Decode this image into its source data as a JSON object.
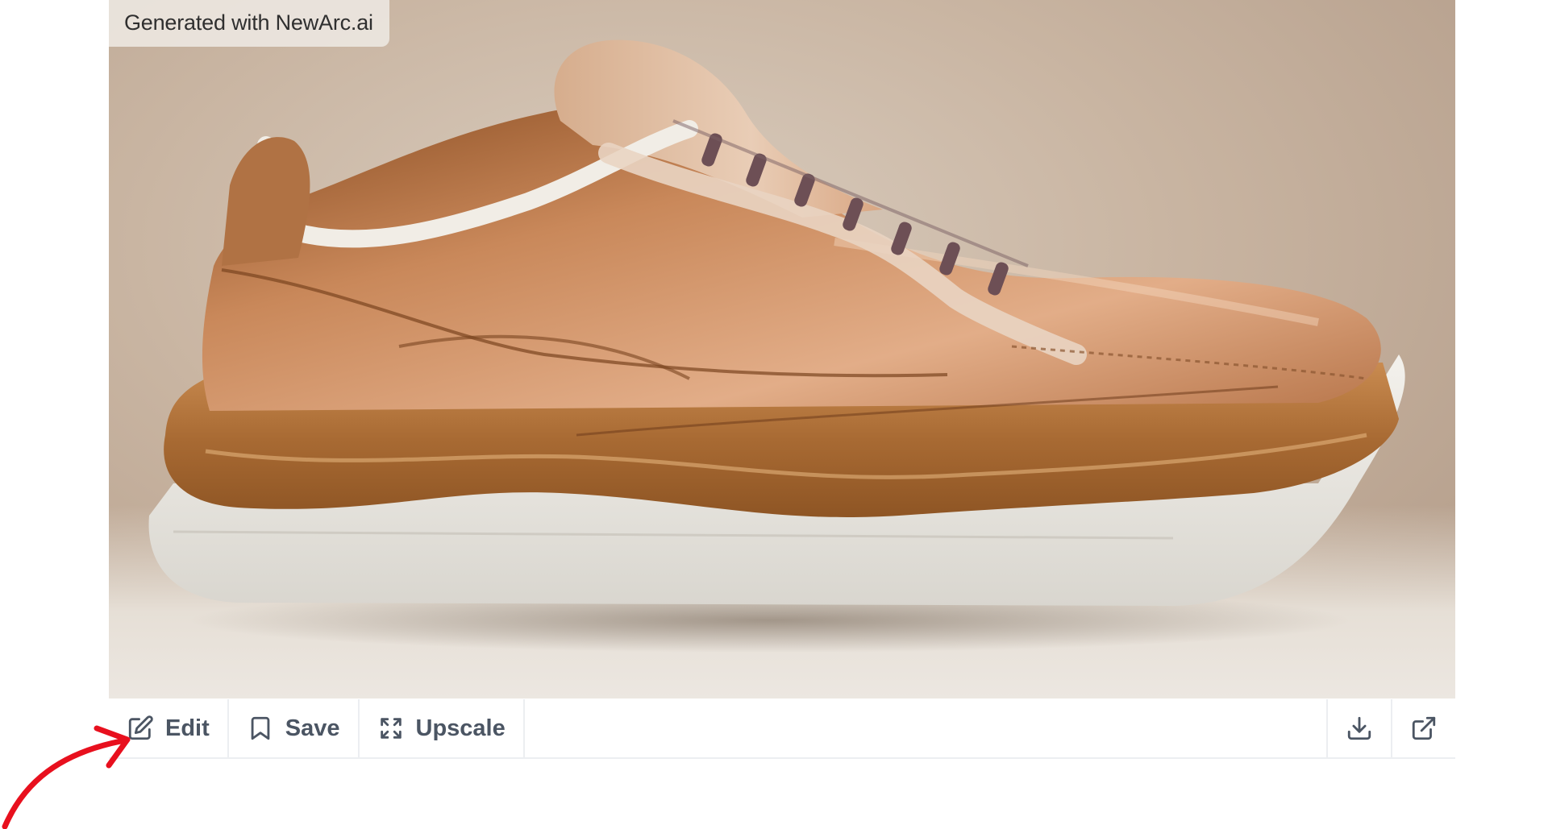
{
  "image": {
    "watermark": "Generated with NewArc.ai",
    "subject": "shoe"
  },
  "toolbar": {
    "edit_label": "Edit",
    "save_label": "Save",
    "upscale_label": "Upscale",
    "download_icon": "download-icon",
    "open_icon": "external-link-icon"
  },
  "annotation": {
    "arrow_color": "#e8101e"
  },
  "colors": {
    "toolbar_text": "#4b5563",
    "border": "#eceef1"
  }
}
